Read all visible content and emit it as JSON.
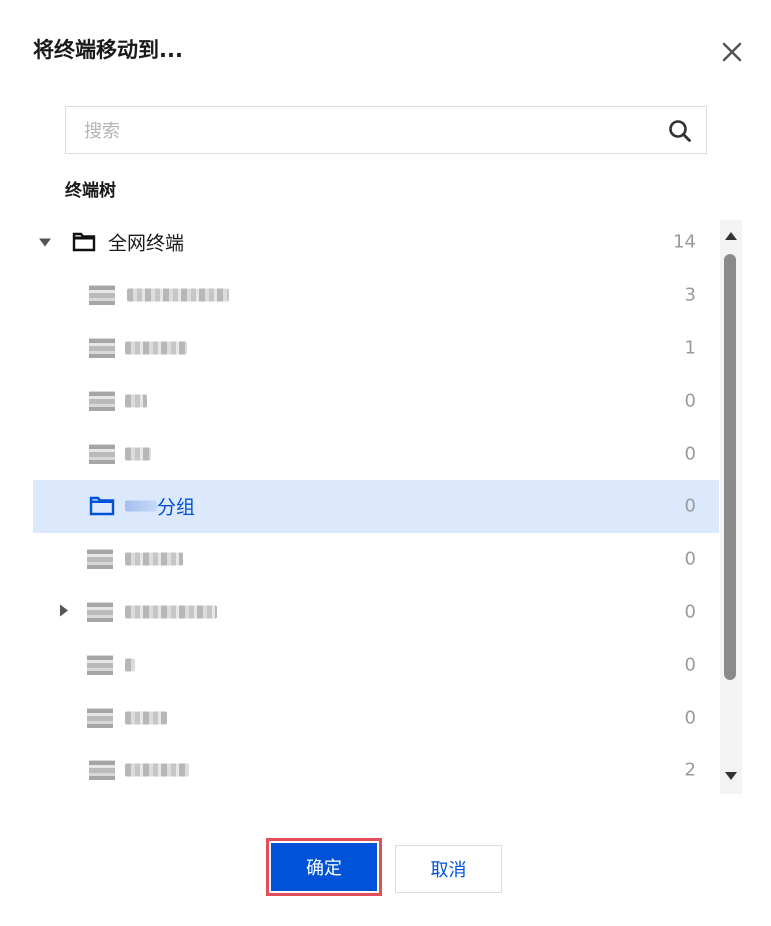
{
  "dialog": {
    "title": "将终端移动到...",
    "close_icon": "close-icon"
  },
  "search": {
    "placeholder": "搜索",
    "icon": "search-icon"
  },
  "section_title": "终端树",
  "tree": {
    "root": {
      "label": "全网终端",
      "count": "14",
      "expanded": true
    },
    "children": [
      {
        "label": "",
        "count": "3",
        "blurred": true,
        "label_width": 102
      },
      {
        "label": "",
        "count": "1",
        "blurred": true,
        "label_width": 62
      },
      {
        "label": "",
        "count": "0",
        "blurred": true,
        "label_width": 22
      },
      {
        "label": "",
        "count": "0",
        "blurred": true,
        "label_width": 26
      },
      {
        "label": "分组",
        "count": "0",
        "blurred": true,
        "selected": true,
        "label_width": 32
      },
      {
        "label": "",
        "count": "0",
        "blurred": true,
        "label_width": 58
      },
      {
        "label": "",
        "count": "0",
        "blurred": true,
        "has_children": true,
        "label_width": 92
      },
      {
        "label": "",
        "count": "0",
        "blurred": true,
        "label_width": 10
      },
      {
        "label": "",
        "count": "0",
        "blurred": true,
        "label_width": 42
      },
      {
        "label": "",
        "count": "2",
        "blurred": true,
        "label_width": 64
      }
    ]
  },
  "buttons": {
    "confirm": "确定",
    "cancel": "取消"
  },
  "colors": {
    "primary": "#0052d9",
    "selected_row": "#dce8fc",
    "highlight_outline": "#e34d59"
  }
}
